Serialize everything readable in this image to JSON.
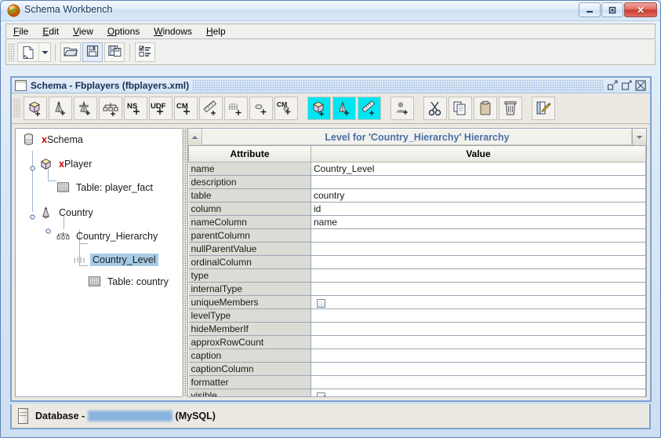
{
  "window": {
    "title": "Schema Workbench",
    "app_icon": "pentaho-sphere-icon",
    "controls": {
      "minimize": "minimize-button",
      "maximize": "maximize-button",
      "close": "close-button",
      "close_glyph": "✕"
    }
  },
  "menubar": {
    "items": [
      {
        "label": "File",
        "mnemonic": "F"
      },
      {
        "label": "Edit",
        "mnemonic": "E"
      },
      {
        "label": "View",
        "mnemonic": "V"
      },
      {
        "label": "Options",
        "mnemonic": "O"
      },
      {
        "label": "Windows",
        "mnemonic": "W"
      },
      {
        "label": "Help",
        "mnemonic": "H"
      }
    ]
  },
  "main_toolbar": {
    "buttons": [
      {
        "name": "new-schema-button",
        "icon": "new-document-icon"
      },
      {
        "name": "new-dropdown-button",
        "icon": "chevron-down-icon"
      },
      {
        "name": "open-button",
        "icon": "open-folder-icon"
      },
      {
        "name": "save-button",
        "icon": "floppy-save-icon"
      },
      {
        "name": "save-as-button",
        "icon": "floppy-save-as-icon"
      },
      {
        "name": "preferences-button",
        "icon": "options-list-icon"
      }
    ]
  },
  "internal_frame": {
    "title": "Schema - Fbplayers (fbplayers.xml)",
    "icon": "window-icon",
    "frame_buttons": [
      {
        "name": "iframe-minimize-button",
        "icon": "iframe-minimize-icon"
      },
      {
        "name": "iframe-maximize-button",
        "icon": "iframe-maximize-icon"
      },
      {
        "name": "iframe-close-button",
        "icon": "iframe-close-icon"
      }
    ],
    "toolbar": [
      {
        "name": "add-cube-button",
        "icon": "cube-plus-icon",
        "label": "",
        "highlight": false
      },
      {
        "name": "add-dimension-button",
        "icon": "dimension-plus-icon",
        "label": "",
        "highlight": false
      },
      {
        "name": "add-dimension-usage-button",
        "icon": "dimension-usage-plus-icon",
        "label": "",
        "highlight": false
      },
      {
        "name": "add-hierarchy-button",
        "icon": "hierarchy-plus-icon",
        "label": "",
        "highlight": false
      },
      {
        "name": "add-named-set-button",
        "icon": "named-set-plus-icon",
        "label": "NS",
        "highlight": false
      },
      {
        "name": "add-user-defined-function-button",
        "icon": "udf-plus-icon",
        "label": "UDF",
        "highlight": false
      },
      {
        "name": "add-calculated-member-button",
        "icon": "calculated-member-plus-icon",
        "label": "CM",
        "highlight": false
      },
      {
        "name": "add-measure-button",
        "icon": "measure-plus-icon",
        "label": "",
        "highlight": false
      },
      {
        "name": "add-level-button",
        "icon": "level-plus-icon",
        "label": "",
        "highlight": false
      },
      {
        "name": "add-property-button",
        "icon": "property-plus-icon",
        "label": "",
        "highlight": false
      },
      {
        "name": "add-calculated-member-property-button",
        "icon": "cm-property-plus-icon",
        "label": "CM",
        "highlight": false
      },
      {
        "name": "add-virtual-cube-button",
        "icon": "virtual-cube-plus-icon",
        "label": "",
        "highlight": true
      },
      {
        "name": "add-virtual-cube-dimension-button",
        "icon": "virtual-dimension-plus-icon",
        "label": "",
        "highlight": true
      },
      {
        "name": "add-virtual-cube-measure-button",
        "icon": "virtual-measure-plus-icon",
        "label": "",
        "highlight": true
      },
      {
        "name": "add-role-button",
        "icon": "user-plus-icon",
        "label": "",
        "highlight": false
      },
      {
        "name": "cut-button",
        "icon": "scissors-icon",
        "label": "",
        "highlight": false
      },
      {
        "name": "copy-button",
        "icon": "copy-pages-icon",
        "label": "",
        "highlight": false
      },
      {
        "name": "paste-button",
        "icon": "clipboard-icon",
        "label": "",
        "highlight": false
      },
      {
        "name": "delete-button",
        "icon": "trash-can-icon",
        "label": "",
        "highlight": false
      },
      {
        "name": "edit-mode-button",
        "icon": "page-pencil-icon",
        "label": "",
        "highlight": false
      }
    ]
  },
  "tree": {
    "nodes": [
      {
        "label": "xSchema",
        "icon": "database-cylinder-icon",
        "depth": 0,
        "prefix_x": "x",
        "text": "Schema",
        "selected": false,
        "expander": "none"
      },
      {
        "label": "xPlayer",
        "icon": "cube-icon",
        "depth": 1,
        "prefix_x": "x",
        "text": "Player",
        "selected": false,
        "expander": "expanded"
      },
      {
        "label": "Table: player_fact",
        "icon": "table-grid-icon",
        "depth": 2,
        "prefix_x": "",
        "text": "Table: player_fact",
        "selected": false,
        "expander": "none"
      },
      {
        "label": "Country",
        "icon": "dimension-icon",
        "depth": 1,
        "prefix_x": "",
        "text": "Country",
        "selected": false,
        "expander": "expanded"
      },
      {
        "label": "Country_Hierarchy",
        "icon": "hierarchy-icon",
        "depth": 2,
        "prefix_x": "",
        "text": "Country_Hierarchy",
        "selected": false,
        "expander": "expanded"
      },
      {
        "label": "Country_Level",
        "icon": "level-icon",
        "depth": 3,
        "prefix_x": "",
        "text": "Country_Level",
        "selected": true,
        "expander": "none"
      },
      {
        "label": "Table: country",
        "icon": "table-grid-icon",
        "depth": 3,
        "prefix_x": "",
        "text": "Table: country",
        "selected": false,
        "expander": "none"
      }
    ],
    "selection_color": "#a8cbe6"
  },
  "properties": {
    "header_title": "Level for 'Country_Hierarchy' Hierarchy",
    "header_title_color": "#4a6fa8",
    "prev_button_icon": "triangle-up-icon",
    "next_button_icon": "triangle-down-icon",
    "columns": [
      "Attribute",
      "Value"
    ],
    "rows": [
      {
        "attribute": "name",
        "value": "Country_Level",
        "type": "text"
      },
      {
        "attribute": "description",
        "value": "",
        "type": "text"
      },
      {
        "attribute": "table",
        "value": "country",
        "type": "text"
      },
      {
        "attribute": "column",
        "value": "id",
        "type": "text"
      },
      {
        "attribute": "nameColumn",
        "value": "name",
        "type": "text"
      },
      {
        "attribute": "parentColumn",
        "value": "",
        "type": "text"
      },
      {
        "attribute": "nullParentValue",
        "value": "",
        "type": "text"
      },
      {
        "attribute": "ordinalColumn",
        "value": "",
        "type": "text"
      },
      {
        "attribute": "type",
        "value": "",
        "type": "text"
      },
      {
        "attribute": "internalType",
        "value": "",
        "type": "text"
      },
      {
        "attribute": "uniqueMembers",
        "value": false,
        "type": "checkbox"
      },
      {
        "attribute": "levelType",
        "value": "",
        "type": "text"
      },
      {
        "attribute": "hideMemberIf",
        "value": "",
        "type": "text"
      },
      {
        "attribute": "approxRowCount",
        "value": "",
        "type": "text"
      },
      {
        "attribute": "caption",
        "value": "",
        "type": "text"
      },
      {
        "attribute": "captionColumn",
        "value": "",
        "type": "text"
      },
      {
        "attribute": "formatter",
        "value": "",
        "type": "text"
      },
      {
        "attribute": "visible",
        "value": true,
        "type": "checkbox"
      }
    ]
  },
  "statusbar": {
    "icon": "database-icon",
    "prefix": "Database - ",
    "redacted_name": "a_006003_players",
    "suffix": " (MySQL)"
  }
}
